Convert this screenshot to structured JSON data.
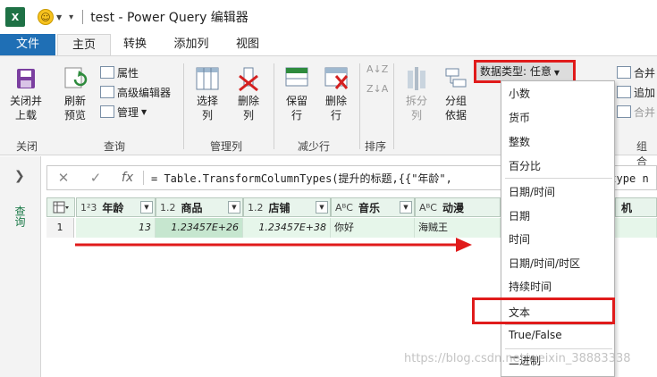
{
  "title": {
    "app_logo": "X",
    "text": "test - Power Query 编辑器"
  },
  "tabs": [
    "文件",
    "主页",
    "转换",
    "添加列",
    "视图"
  ],
  "ribbon": {
    "close_apply": [
      "关闭并",
      "上载"
    ],
    "refresh": [
      "刷新",
      "预览"
    ],
    "properties": "属性",
    "advanced_editor": "高级编辑器",
    "manage": "管理",
    "choose_cols": [
      "选择",
      "列"
    ],
    "remove_cols": [
      "删除",
      "列"
    ],
    "keep_rows": [
      "保留",
      "行"
    ],
    "remove_rows": [
      "删除",
      "行"
    ],
    "split": [
      "拆分",
      "列"
    ],
    "group_by": [
      "分组",
      "依据"
    ],
    "data_type": "数据类型: 任意",
    "merge": "合并",
    "append": "追加",
    "combine": "合并",
    "groups": [
      "关闭",
      "查询",
      "管理列",
      "减少行",
      "排序",
      "组合"
    ]
  },
  "nav": {
    "label": "查询"
  },
  "formula_bar": {
    "cancel": "✕",
    "confirm": "✓",
    "fx": "fx",
    "formula": "= Table.TransformColumnTypes(提升的标题,{{\"年龄\",",
    "formula_tail": ", type n"
  },
  "grid": {
    "columns": [
      {
        "type": "1²3",
        "name": "年龄"
      },
      {
        "type": "1.2",
        "name": "商品"
      },
      {
        "type": "1.2",
        "name": "店铺"
      },
      {
        "type": "AᴮC",
        "name": "音乐"
      },
      {
        "type": "AᴮC",
        "name": "动漫"
      },
      {
        "type": "",
        "name": "机"
      }
    ],
    "rows": [
      {
        "no": "1",
        "cells": [
          "13",
          "1.23457E+26",
          "1.23457E+38",
          "你好",
          "海贼王"
        ]
      }
    ]
  },
  "datatype_menu": {
    "items": [
      "小数",
      "货币",
      "整数",
      "百分比",
      "日期/时间",
      "日期",
      "时间",
      "日期/时间/时区",
      "持续时间",
      "文本",
      "True/False",
      "二进制"
    ],
    "highlighted": "文本"
  },
  "watermark": "https://blog.csdn.net/weixin_38883338",
  "colors": {
    "file_tab": "#1f6fb5",
    "highlight": "#e01b1b",
    "grid_header": "#e8f4ec"
  }
}
